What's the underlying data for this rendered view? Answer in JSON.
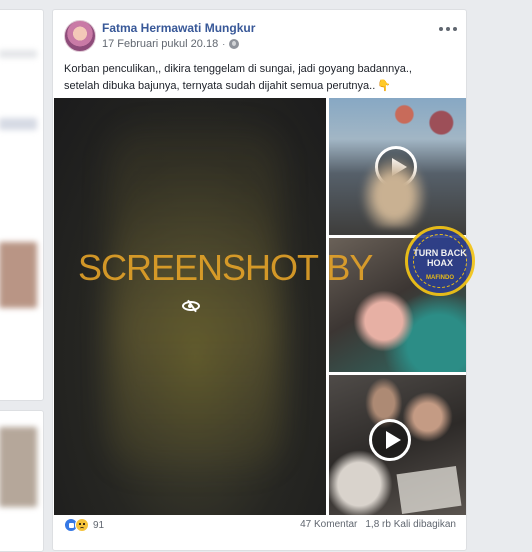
{
  "post": {
    "author": "Fatma Hermawati Mungkur",
    "timestamp": "17 Februari pukul 20.18",
    "separator": "·",
    "text_lines": [
      "Korban penculikan,, dikira tenggelam di sungai, jadi goyang badannya.,",
      "setelah dibuka bajunya, ternyata sudah dijahit semua perutnya.."
    ],
    "emoji": "👇",
    "icons": {
      "privacy": "globe-icon",
      "options": "more-icon",
      "video": "play-icon",
      "sensitive": "hidden-eye-icon"
    }
  },
  "overlay": {
    "watermark": "SCREENSHOT BY",
    "badge_main": "TURN BACK HOAX",
    "badge_sub": "MAFINDO"
  },
  "footer": {
    "reaction_icons": [
      "like-icon",
      "sad-icon"
    ],
    "reaction_count": "91",
    "comments": "47 Komentar",
    "shares": "1,8 rb Kali dibagikan"
  },
  "colors": {
    "author_link": "#385898",
    "watermark": "#e8a528",
    "badge_fill": "#2d3f8c",
    "badge_border": "#f2c417",
    "like": "#3578e5",
    "sad": "#f5c33b"
  }
}
